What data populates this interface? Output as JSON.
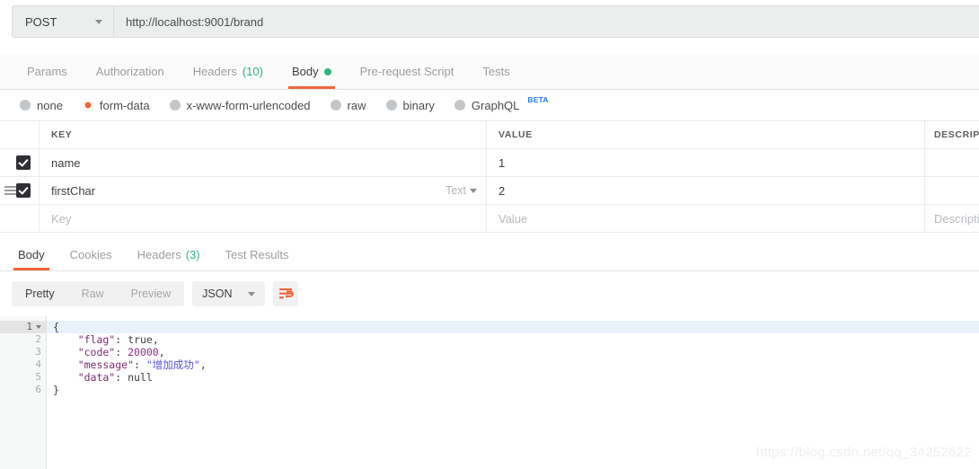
{
  "request_bar": {
    "method": "POST",
    "method_icon": "chevron-down-icon",
    "url": "http://localhost:9001/brand"
  },
  "request_tabs": [
    {
      "label": "Params",
      "active": false
    },
    {
      "label": "Authorization",
      "active": false
    },
    {
      "label": "Headers",
      "count": "(10)",
      "active": false
    },
    {
      "label": "Body",
      "active": true,
      "dot": true
    },
    {
      "label": "Pre-request Script",
      "active": false
    },
    {
      "label": "Tests",
      "active": false
    }
  ],
  "body_types": [
    {
      "label": "none",
      "selected": false
    },
    {
      "label": "form-data",
      "selected": true
    },
    {
      "label": "x-www-form-urlencoded",
      "selected": false
    },
    {
      "label": "raw",
      "selected": false
    },
    {
      "label": "binary",
      "selected": false
    },
    {
      "label": "GraphQL",
      "selected": false,
      "badge": "BETA"
    }
  ],
  "kv_table": {
    "headers": {
      "key": "KEY",
      "value": "VALUE",
      "description": "DESCRIPTION"
    },
    "rows": [
      {
        "checked": true,
        "key": "name",
        "value": "1",
        "description": "",
        "type": "",
        "handle": false
      },
      {
        "checked": true,
        "key": "firstChar",
        "value": "2",
        "description": "",
        "type": "Text",
        "handle": true
      }
    ],
    "placeholder_row": {
      "key": "Key",
      "value": "Value",
      "description": "Description"
    }
  },
  "response_tabs": [
    {
      "label": "Body",
      "active": true
    },
    {
      "label": "Cookies",
      "active": false
    },
    {
      "label": "Headers",
      "count": "(3)",
      "active": false
    },
    {
      "label": "Test Results",
      "active": false
    }
  ],
  "response_toolbar": {
    "view_modes": [
      {
        "label": "Pretty",
        "active": true
      },
      {
        "label": "Raw",
        "active": false
      },
      {
        "label": "Preview",
        "active": false
      }
    ],
    "format": "JSON",
    "format_icon": "chevron-down-icon",
    "wrap_icon": "word-wrap-icon"
  },
  "response_body": {
    "language": "json",
    "lines": [
      {
        "n": "1",
        "foldable": true,
        "current": true,
        "tokens": [
          {
            "t": "punct",
            "s": "{"
          }
        ]
      },
      {
        "n": "2",
        "foldable": false,
        "current": false,
        "tokens": [
          {
            "t": "key",
            "s": "    \"flag\""
          },
          {
            "t": "punct",
            "s": ": "
          },
          {
            "t": "bool",
            "s": "true"
          },
          {
            "t": "punct",
            "s": ","
          }
        ]
      },
      {
        "n": "3",
        "foldable": false,
        "current": false,
        "tokens": [
          {
            "t": "key",
            "s": "    \"code\""
          },
          {
            "t": "punct",
            "s": ": "
          },
          {
            "t": "num",
            "s": "20000"
          },
          {
            "t": "punct",
            "s": ","
          }
        ]
      },
      {
        "n": "4",
        "foldable": false,
        "current": false,
        "tokens": [
          {
            "t": "key",
            "s": "    \"message\""
          },
          {
            "t": "punct",
            "s": ": "
          },
          {
            "t": "str",
            "s": "\"增加成功\""
          },
          {
            "t": "punct",
            "s": ","
          }
        ]
      },
      {
        "n": "5",
        "foldable": false,
        "current": false,
        "tokens": [
          {
            "t": "key",
            "s": "    \"data\""
          },
          {
            "t": "punct",
            "s": ": "
          },
          {
            "t": "null",
            "s": "null"
          }
        ]
      },
      {
        "n": "6",
        "foldable": false,
        "current": false,
        "tokens": [
          {
            "t": "punct",
            "s": "}"
          }
        ]
      }
    ]
  },
  "watermark": "https://blog.csdn.net/qq_34252622",
  "colors": {
    "accent_orange": "#f0673a",
    "green_dot": "#2fb67c",
    "count_green": "#2db47d",
    "beta_blue": "#2a7ae2",
    "checkbox_dark": "#2f3033",
    "current_line": "#e8f2fb"
  }
}
